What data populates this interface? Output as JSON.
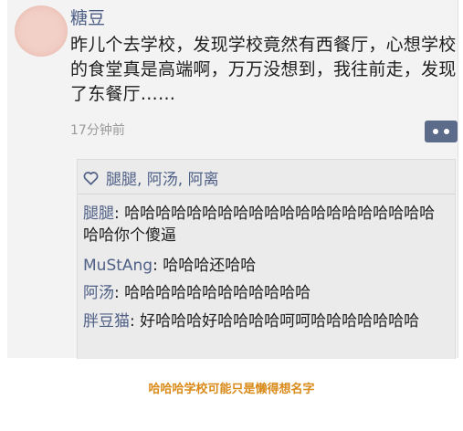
{
  "post": {
    "username": "糖豆",
    "text": "昨儿个去学校，发现学校竟然有西餐厅，心想学校的食堂真是高端啊，万万没想到，我往前走，发现了东餐厅……",
    "timestamp": "17分钟前",
    "more_icon": "ellipsis-icon"
  },
  "likes": {
    "icon": "heart-icon",
    "names": "腿腿, 阿汤, 阿离"
  },
  "comments": [
    {
      "name": "腿腿",
      "text": "哈哈哈哈哈哈哈哈哈哈哈哈哈哈哈哈哈哈哈哈哈哈你个傻逼"
    },
    {
      "name": "MuStAng",
      "text": "哈哈哈还哈哈"
    },
    {
      "name": "阿汤",
      "text": "哈哈哈哈哈哈哈哈哈哈哈哈"
    },
    {
      "name": "胖豆猫",
      "text": "好哈哈哈好哈哈哈哈呵呵哈哈哈哈哈哈哈"
    }
  ],
  "caption": "哈哈哈学校可能只是懒得想名字",
  "colors": {
    "link": "#4e5f86",
    "caption": "#d98a19"
  }
}
